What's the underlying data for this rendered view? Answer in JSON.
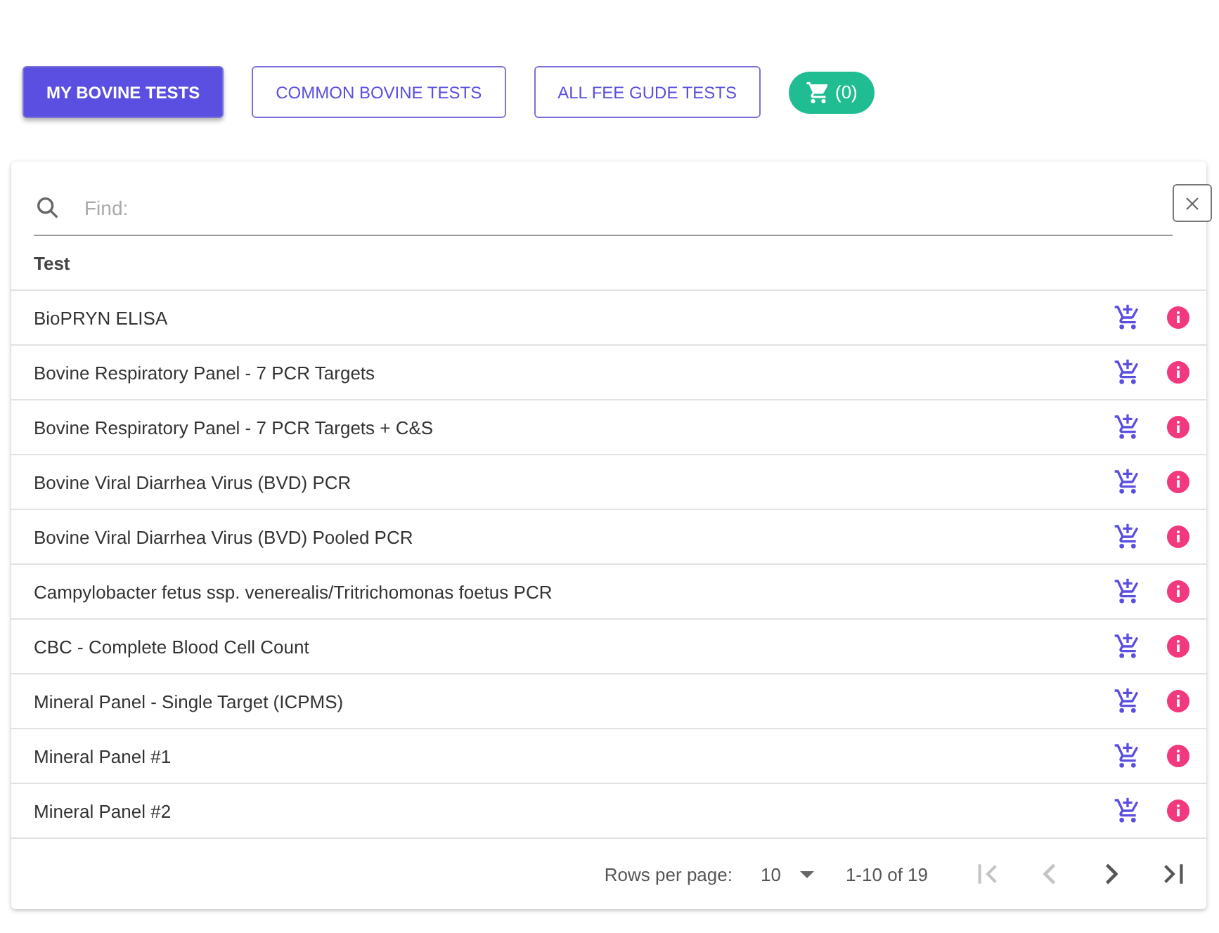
{
  "tabs": [
    {
      "label": "MY BOVINE TESTS",
      "selected": true
    },
    {
      "label": "COMMON BOVINE TESTS",
      "selected": false
    },
    {
      "label": "ALL FEE GUDE TESTS",
      "selected": false
    }
  ],
  "cart": {
    "count": "(0)"
  },
  "search": {
    "placeholder": "Find:"
  },
  "table": {
    "columns": [
      "Test"
    ],
    "rows": [
      {
        "test": "BioPRYN ELISA"
      },
      {
        "test": "Bovine Respiratory Panel - 7 PCR Targets"
      },
      {
        "test": "Bovine Respiratory Panel - 7 PCR Targets + C&S"
      },
      {
        "test": "Bovine Viral Diarrhea Virus (BVD) PCR"
      },
      {
        "test": "Bovine Viral Diarrhea Virus (BVD) Pooled PCR"
      },
      {
        "test": "Campylobacter fetus ssp. venerealis/Tritrichomonas foetus PCR"
      },
      {
        "test": "CBC - Complete Blood Cell Count"
      },
      {
        "test": "Mineral Panel - Single Target (ICPMS)"
      },
      {
        "test": "Mineral Panel #1"
      },
      {
        "test": "Mineral Panel #2"
      }
    ]
  },
  "pagination": {
    "rows_per_page_label": "Rows per page:",
    "rows_per_page": "10",
    "range": "1-10 of 19",
    "buttons": [
      {
        "kind": "first",
        "disabled": true
      },
      {
        "kind": "prev",
        "disabled": true
      },
      {
        "kind": "next",
        "disabled": false
      },
      {
        "kind": "last",
        "disabled": false
      }
    ]
  }
}
